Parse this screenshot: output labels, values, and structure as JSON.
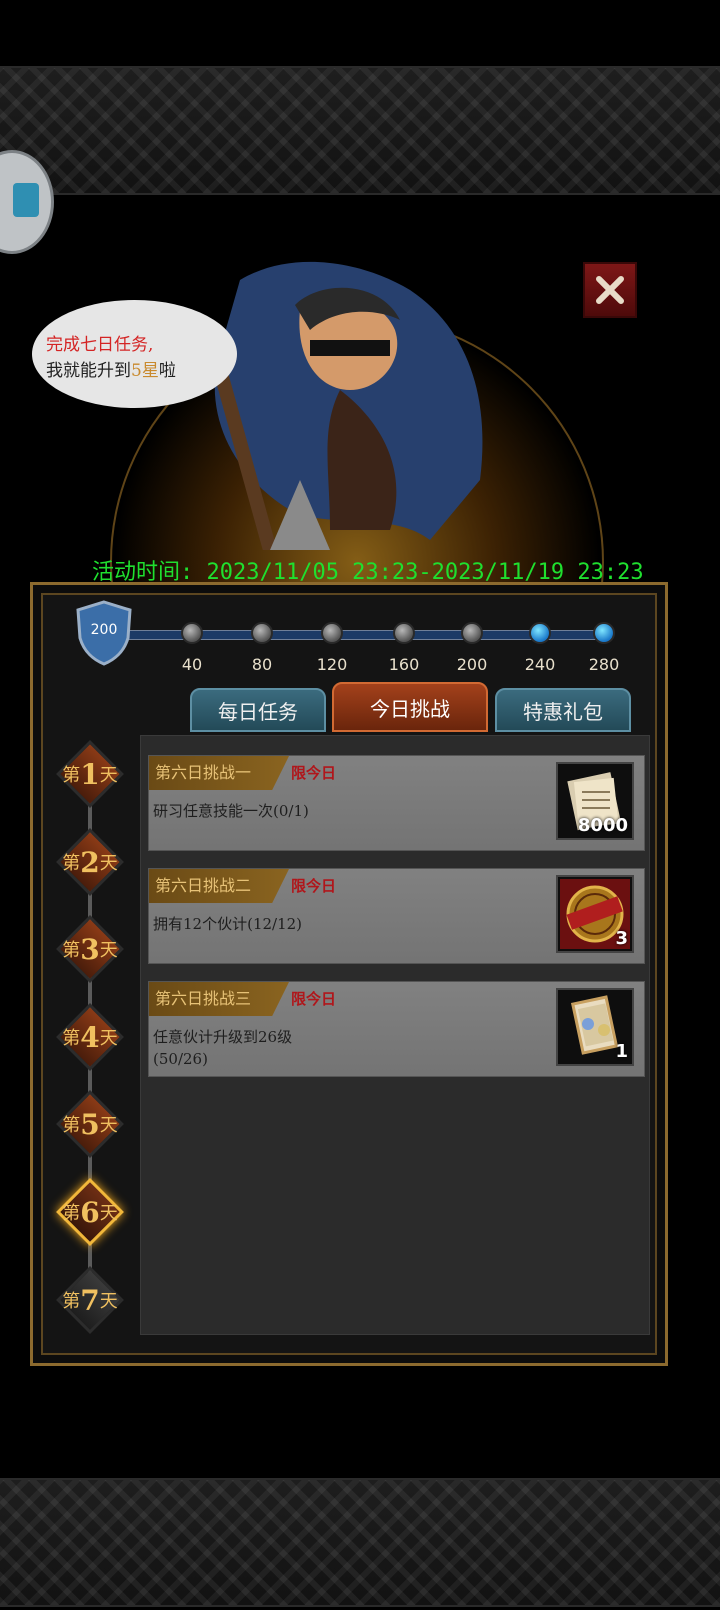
{
  "banner": {
    "speech_line1": "完成七日任务,",
    "speech_line2_prefix": "我就能升到",
    "speech_line2_highlight": "5星",
    "speech_line2_suffix": "啦",
    "event_time": "活动时间: 2023/11/05 23:23-2023/11/19 23:23"
  },
  "progress": {
    "current_points": "200",
    "milestones": [
      "40",
      "80",
      "120",
      "160",
      "200",
      "240",
      "280"
    ],
    "milestone_active": [
      false,
      false,
      false,
      false,
      false,
      true,
      true
    ]
  },
  "tabs": [
    {
      "label": "每日任务",
      "active": false
    },
    {
      "label": "今日挑战",
      "active": true
    },
    {
      "label": "特惠礼包",
      "active": false
    }
  ],
  "days": [
    {
      "prefix": "第",
      "num": "1",
      "suffix": "天",
      "state": "done"
    },
    {
      "prefix": "第",
      "num": "2",
      "suffix": "天",
      "state": "done"
    },
    {
      "prefix": "第",
      "num": "3",
      "suffix": "天",
      "state": "done"
    },
    {
      "prefix": "第",
      "num": "4",
      "suffix": "天",
      "state": "done"
    },
    {
      "prefix": "第",
      "num": "5",
      "suffix": "天",
      "state": "done"
    },
    {
      "prefix": "第",
      "num": "6",
      "suffix": "天",
      "state": "active"
    },
    {
      "prefix": "第",
      "num": "7",
      "suffix": "天",
      "state": "todo"
    }
  ],
  "tasks": [
    {
      "title": "第六日挑战一",
      "limit": "限今日",
      "desc": "研习任意技能一次(0/1)",
      "reward_icon": "scroll-icon",
      "reward_count": "8000"
    },
    {
      "title": "第六日挑战二",
      "limit": "限今日",
      "desc": "拥有12个伙计(12/12)",
      "reward_icon": "claimed-seal-icon",
      "reward_count": "3"
    },
    {
      "title": "第六日挑战三",
      "limit": "限今日",
      "desc": "任意伙计升级到26级(50/26)",
      "reward_icon": "card-icon",
      "reward_count": "1"
    }
  ]
}
